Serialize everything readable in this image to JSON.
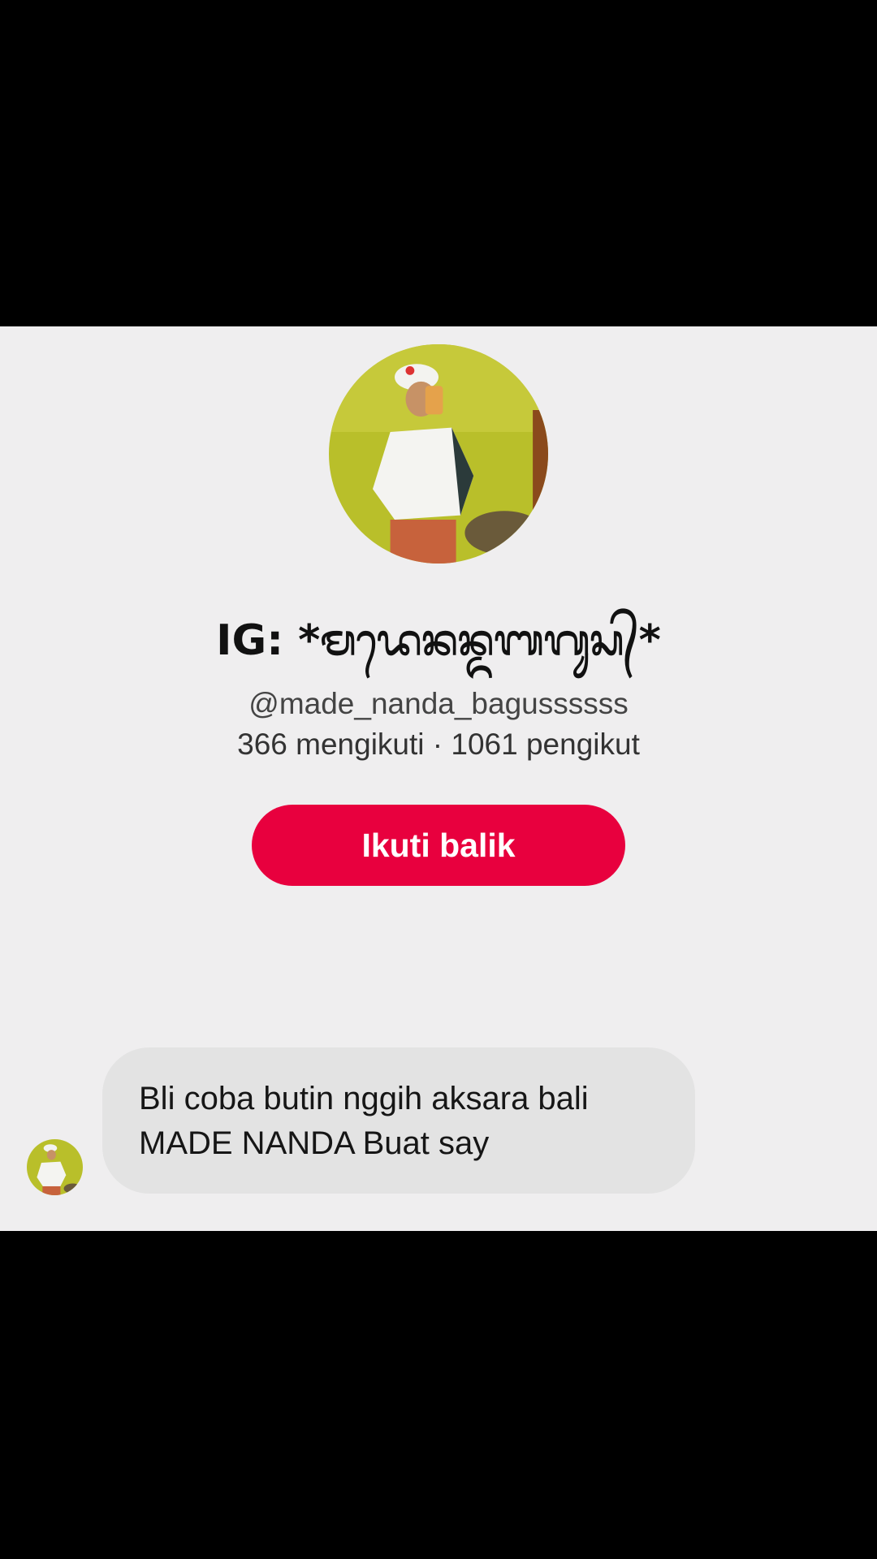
{
  "profile": {
    "display_name": "IG: *ᬫᬤᬾᬦᬦ᭄ᬤᬩᬕᬸᬲ᭄*",
    "username": "@made_nanda_bagussssss",
    "stats_text": "366 mengikuti · 1061 pengikut",
    "follow_button_label": "Ikuti balik"
  },
  "message": {
    "line_1": "Bli coba butin nggih aksara bali",
    "line_2": "MADE NANDA Buat say"
  },
  "colors": {
    "background": "#efeeef",
    "accent": "#e8003e",
    "bubble": "#e3e3e3",
    "letterbox": "#000000"
  },
  "icons": {
    "profile_avatar": "profile-photo",
    "sender_avatar": "profile-photo"
  }
}
